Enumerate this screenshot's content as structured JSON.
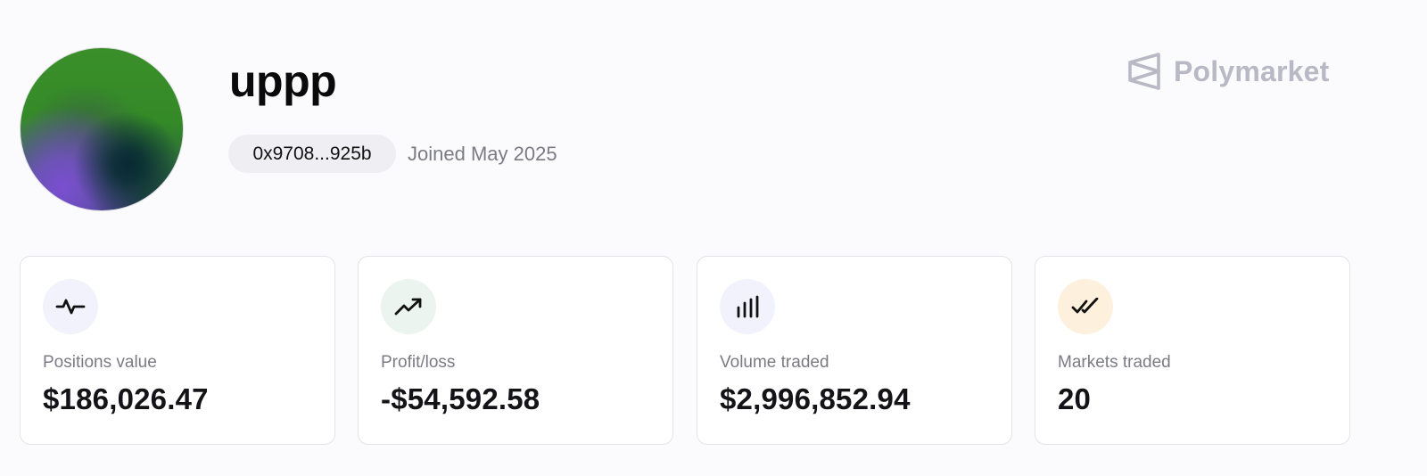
{
  "profile": {
    "username": "uppp",
    "wallet": "0x9708...925b",
    "joined": "Joined May 2025"
  },
  "brand": {
    "name": "Polymarket",
    "icon": "polymarket-logo-icon",
    "color": "#b9b9c6"
  },
  "stats": [
    {
      "label": "Positions value",
      "value": "$186,026.47",
      "icon": "activity-icon",
      "icon_bg": "#f1f2fc"
    },
    {
      "label": "Profit/loss",
      "value": "-$54,592.58",
      "icon": "trending-up-icon",
      "icon_bg": "#ebf4ef"
    },
    {
      "label": "Volume traded",
      "value": "$2,996,852.94",
      "icon": "bar-chart-icon",
      "icon_bg": "#f1f2fc"
    },
    {
      "label": "Markets traded",
      "value": "20",
      "icon": "double-check-icon",
      "icon_bg": "#fdf1de"
    }
  ]
}
